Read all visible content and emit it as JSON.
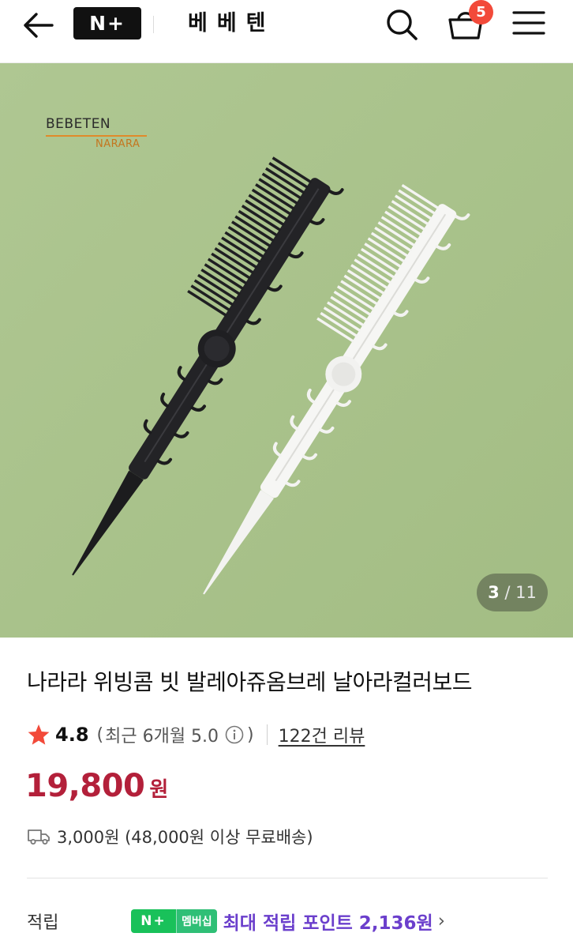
{
  "header": {
    "logo_text": "N+",
    "store_name": "베베텐",
    "cart_count": "5",
    "icons": {
      "back": "back-arrow-icon",
      "search": "search-icon",
      "cart": "cart-icon",
      "menu": "hamburger-menu-icon"
    }
  },
  "hero": {
    "brand_main": "BEBETEN",
    "brand_sub": "NARARA",
    "counter": {
      "current": "3",
      "separator": "/",
      "total": "11"
    },
    "colors": {
      "background": "#a9c28a"
    }
  },
  "product": {
    "title": "나라라 위빙콤 빗 발레아쥬옴브레 날아라컬러보드",
    "rating": "4.8",
    "recent_open": "(",
    "recent_label": "최근 6개월 5.0",
    "recent_close": ")",
    "reviews": "122건 리뷰",
    "price": "19,800",
    "price_unit": "원",
    "shipping": "3,000원 (48,000원 이상 무료배송)",
    "points_label": "적립",
    "membership_badge": "멤버십",
    "membership_logo": "N+",
    "points_text": "최대 적립 포인트 2,136원",
    "chevron": "›",
    "colors": {
      "price": "#b3203a",
      "points": "#6b3fcc",
      "badge": "#19c15a",
      "star": "#f24a3a"
    }
  }
}
